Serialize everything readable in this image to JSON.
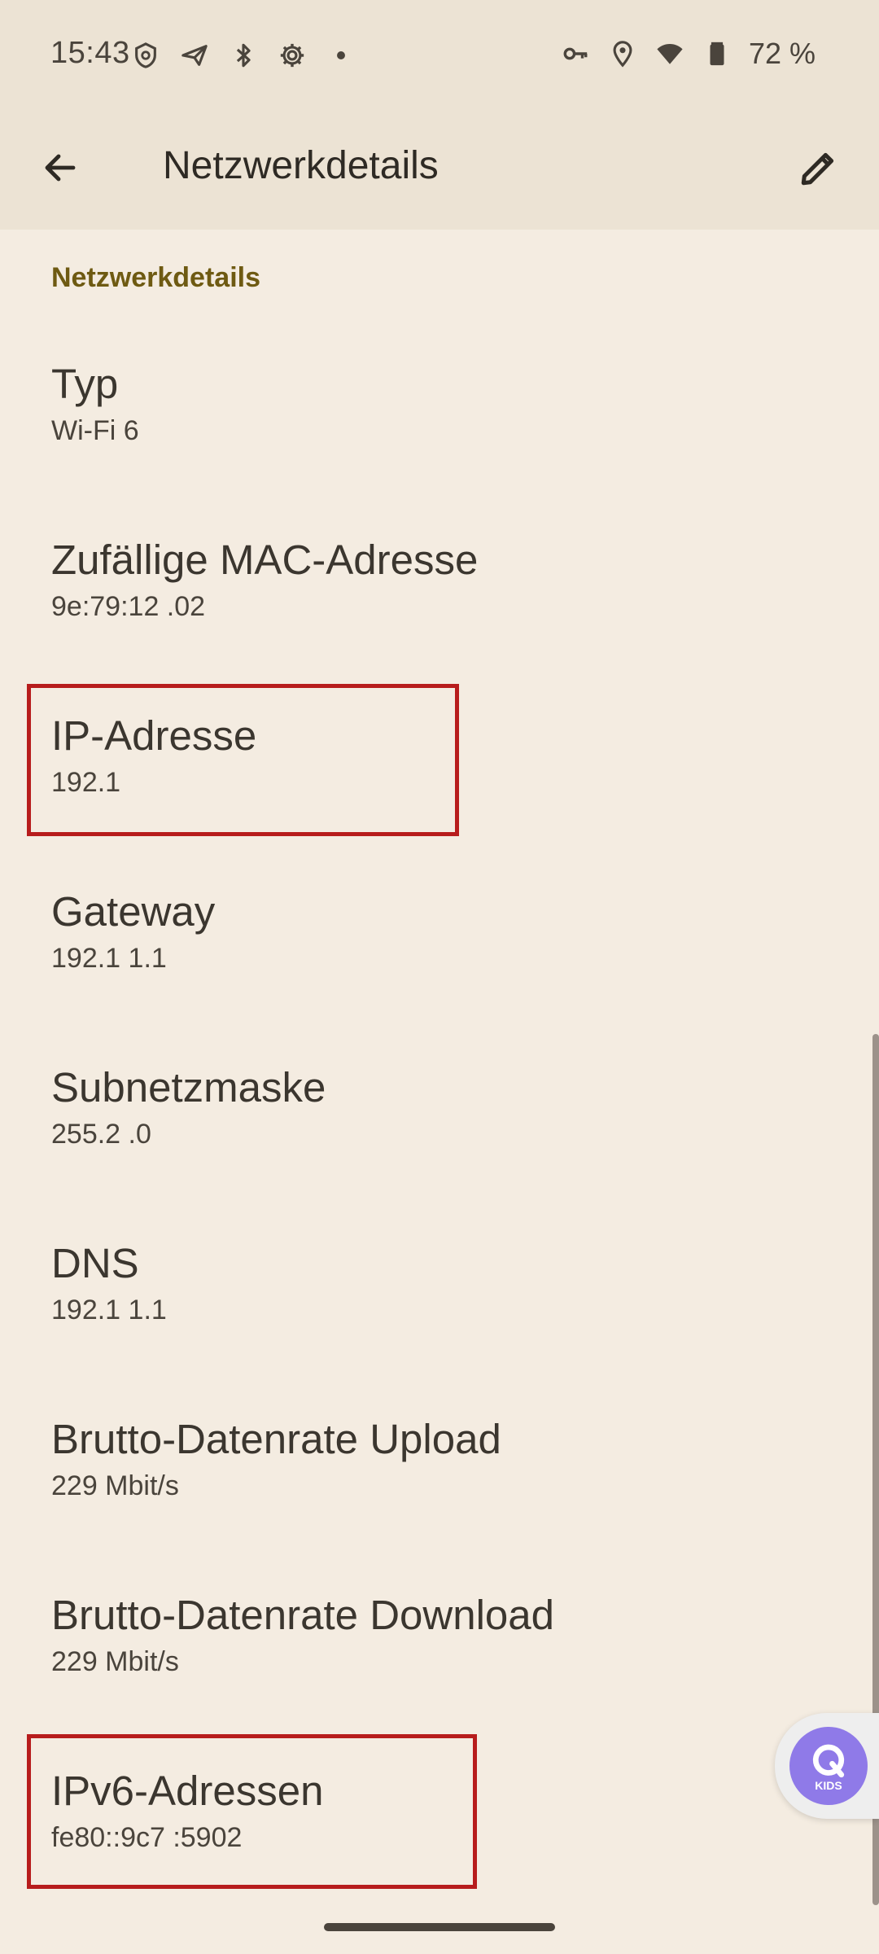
{
  "status_bar": {
    "time": "15:43",
    "battery": "72 %",
    "left_icons": [
      "vpn-shield-icon",
      "send-icon",
      "bluetooth-icon",
      "settings-gear-icon",
      "dot-icon"
    ],
    "right_icons": [
      "key-icon",
      "location-icon",
      "wifi-icon",
      "battery-icon"
    ]
  },
  "app_bar": {
    "title": "Netzwerkdetails"
  },
  "section": {
    "header": "Netzwerkdetails"
  },
  "details": [
    {
      "title": "Typ",
      "value": "Wi-Fi 6"
    },
    {
      "title": "Zufällige MAC-Adresse",
      "value": "9e:79:12          .02"
    },
    {
      "title": "IP-Adresse",
      "value": "192.1"
    },
    {
      "title": "Gateway",
      "value": "192.1   1.1"
    },
    {
      "title": "Subnetzmaske",
      "value": "255.2          .0"
    },
    {
      "title": "DNS",
      "value": "192.1     1.1"
    },
    {
      "title": "Brutto-Datenrate Upload",
      "value": "229 Mbit/s"
    },
    {
      "title": "Brutto-Datenrate Download",
      "value": "229 Mbit/s"
    },
    {
      "title": "IPv6-Adressen",
      "value": "fe80::9c7                  :5902"
    }
  ],
  "kids_badge": {
    "label": "KIDS"
  },
  "colors": {
    "background": "#f4ece1",
    "topbar": "#ece3d4",
    "section_accent": "#6e5a12",
    "highlight": "#b71c1c",
    "kids_purple": "#8f7ae8"
  }
}
